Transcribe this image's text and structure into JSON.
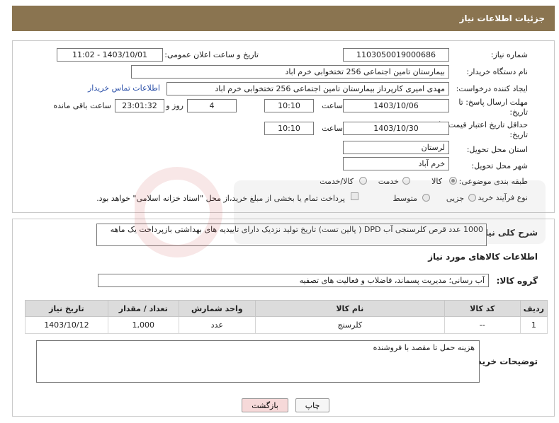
{
  "header": {
    "title": "جزئیات اطلاعات نیاز"
  },
  "form": {
    "need_number": {
      "label": "شماره نیاز:",
      "value": "1103050019000686"
    },
    "announce_datetime": {
      "label": "تاریخ و ساعت اعلان عمومی:",
      "value": "1403/10/01 - 11:02"
    },
    "buyer_org": {
      "label": "نام دستگاه خریدار:",
      "value": "بیمارستان تامین اجتماعی  256 تختخوابی خرم اباد"
    },
    "requester": {
      "label": "ایجاد کننده درخواست:",
      "value": "مهدی امیری کارپرداز بیمارستان تامین اجتماعی  256 تختخوابی خرم اباد",
      "contact_link": "اطلاعات تماس خریدار"
    },
    "reply_deadline": {
      "label_line1": "مهلت ارسال پاسخ: تا",
      "label_line2": "تاریخ:",
      "date": "1403/10/06",
      "time_label": "ساعت",
      "time": "10:10",
      "days": "4",
      "days_label": "روز و",
      "remaining": "23:01:32",
      "remaining_label": "ساعت باقی مانده"
    },
    "price_validity": {
      "label_line1": "حداقل تاریخ اعتبار قیمت: تا",
      "label_line2": "تاریخ:",
      "date": "1403/10/30",
      "time_label": "ساعت",
      "time": "10:10"
    },
    "province": {
      "label": "استان محل تحویل:",
      "value": "لرستان"
    },
    "city": {
      "label": "شهر محل تحویل:",
      "value": "خرم آباد"
    },
    "category": {
      "label": "طبقه بندی موضوعی:",
      "options": [
        {
          "label": "کالا",
          "selected": true
        },
        {
          "label": "خدمت",
          "selected": false
        },
        {
          "label": "کالا/خدمت",
          "selected": false
        }
      ]
    },
    "purchase_type": {
      "label": "نوع فرآیند خرید :",
      "options": [
        {
          "label": "جزیی",
          "selected": false
        },
        {
          "label": "متوسط",
          "selected": false
        }
      ],
      "checkbox_text": "پرداخت تمام یا بخشی از مبلغ خرید،از محل \"اسناد خزانه اسلامی\" خواهد بود."
    }
  },
  "description": {
    "label": "شرح کلی نیاز:",
    "value": "1000 عدد قرص کلرسنجی آب DPD ( پالین تست) تاریخ تولید نزدیک دارای تاییدیه های بهداشتی بازپرداخت یک ماهه"
  },
  "goods_section": {
    "title": "اطلاعات کالاهای مورد نیاز"
  },
  "goods_group": {
    "label": "گروه کالا:",
    "value": "آب رسانی؛ مدیریت پسماند، فاضلاب و فعالیت های تصفیه"
  },
  "items_table": {
    "headers": [
      "ردیف",
      "کد کالا",
      "نام کالا",
      "واحد شمارش",
      "تعداد / مقدار",
      "تاریخ نیاز"
    ],
    "rows": [
      [
        "1",
        "--",
        "کلرسنج",
        "عدد",
        "1,000",
        "1403/10/12"
      ]
    ]
  },
  "buyer_notes": {
    "label": "توضیحات خریدار:",
    "value": "هزینه حمل تا مقصد با فروشنده"
  },
  "buttons": {
    "print": "چاپ",
    "back": "بازگشت"
  },
  "colors": {
    "header_bg": "#8a7450",
    "link": "#2a4fa8",
    "back_button_bg": "#f6d9d9",
    "table_header_bg": "#dcdcdc"
  }
}
